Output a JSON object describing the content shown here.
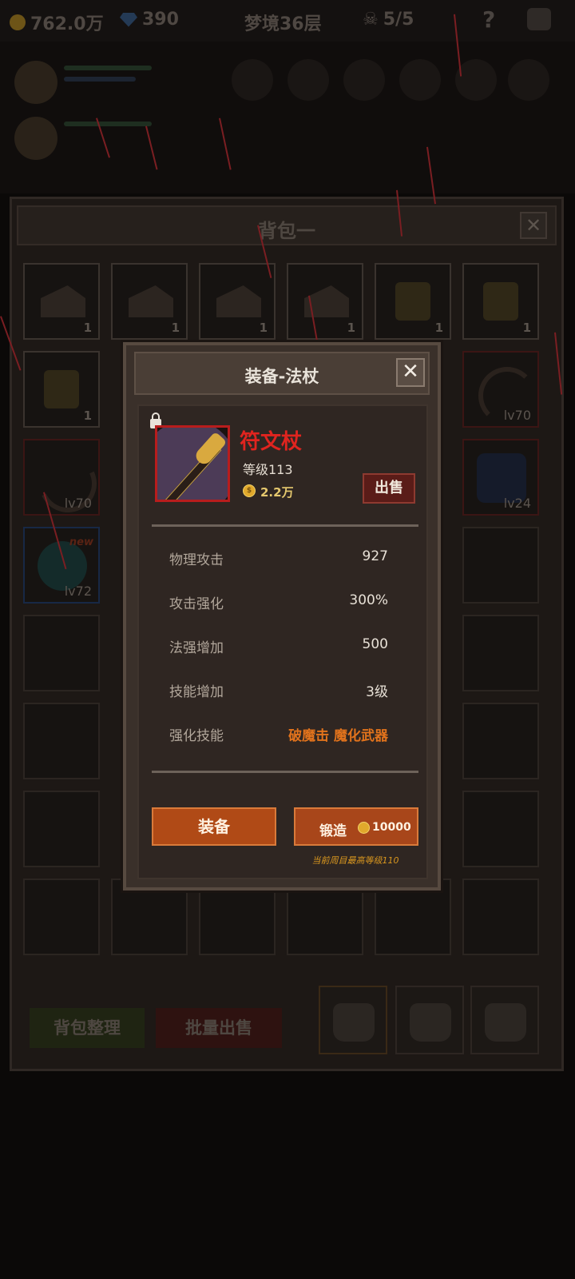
{
  "topbar": {
    "gold": "762.0万",
    "gems": "390",
    "stage": "梦境36层",
    "keys": "5/5"
  },
  "backpack": {
    "title": "背包一",
    "close_label": "✕",
    "slots": [
      {
        "kind": "cake",
        "count": "1"
      },
      {
        "kind": "cake",
        "count": "1"
      },
      {
        "kind": "cake",
        "count": "1"
      },
      {
        "kind": "cake",
        "count": "1"
      },
      {
        "kind": "mug",
        "count": "1"
      },
      {
        "kind": "mug",
        "count": "1"
      },
      {
        "kind": "mug",
        "count": "1"
      },
      {
        "kind": "bow",
        "level": "lv70"
      },
      {
        "kind": "weapon",
        "level": "lv70"
      },
      {
        "kind": "armor",
        "level": "lv24"
      },
      {
        "kind": "orb",
        "level": "lv72",
        "badge": "new"
      }
    ],
    "sort_button": "背包整理",
    "bulk_sell_button": "批量出售"
  },
  "dialog": {
    "title": "装备-法杖",
    "close_label": "✕",
    "item_name": "符文杖",
    "item_level": "等级113",
    "item_price": "2.2万",
    "coin_symbol": "$",
    "sell_button": "出售",
    "stats": [
      {
        "label": "物理攻击",
        "value": "927"
      },
      {
        "label": "攻击强化",
        "value": "300%"
      },
      {
        "label": "法强增加",
        "value": "500"
      },
      {
        "label": "技能增加",
        "value": "3级"
      },
      {
        "label": "强化技能",
        "value": "破魔击 魔化武器"
      }
    ],
    "equip_button": "装备",
    "forge_button": "锻造",
    "forge_cost": "10000",
    "forge_note": "当前周目最高等级110"
  },
  "colors": {
    "item_name": "#e0241f",
    "accent_orange": "#e2731c",
    "button_orange": "#b04a16"
  }
}
